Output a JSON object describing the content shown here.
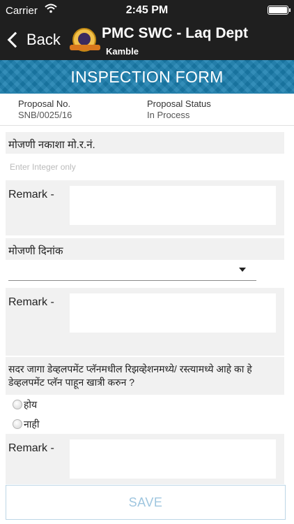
{
  "status_bar": {
    "carrier": "Carrier",
    "time": "2:45 PM"
  },
  "nav": {
    "back_label": "Back",
    "title": "PMC SWC - Laq Dept",
    "subtitle": "Kamble"
  },
  "banner": {
    "title": "INSPECTION FORM"
  },
  "proposal": {
    "number_label": "Proposal No.",
    "number_value": "SNB/0025/16",
    "status_label": "Proposal Status",
    "status_value": "In Process"
  },
  "form": {
    "q1": {
      "label": "मोजणी नकाशा मो.र.नं.",
      "placeholder": "Enter Integer only",
      "remark_label": "Remark -"
    },
    "q2": {
      "label": "मोजणी दिनांक",
      "remark_label": "Remark -"
    },
    "q3": {
      "label_line1": "सदर जागा डेव्हलपमेंट प्लॅनमधील रिझव्हेशनमध्ये/ रस्त्यामध्ये आहे का हे",
      "label_line2": "डेव्हलपमेंट प्लॅन पाहून खात्री करुन ?",
      "options": [
        "होय",
        "नाही"
      ],
      "remark_label": "Remark -"
    }
  },
  "actions": {
    "save_label": "SAVE"
  },
  "colors": {
    "banner": "#1b80b0",
    "nav": "#1f1f1f",
    "save_text": "#9fc6df"
  }
}
